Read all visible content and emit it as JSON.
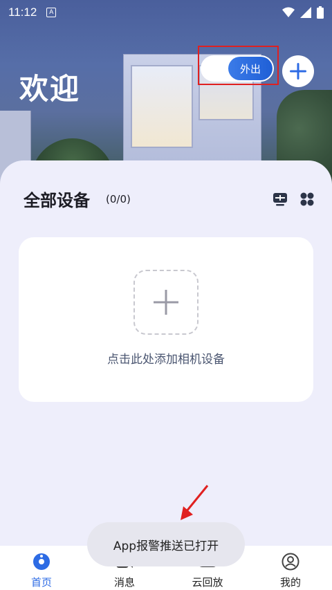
{
  "status_bar": {
    "time": "11:12",
    "notification_icon": "A"
  },
  "header": {
    "welcome": "欢迎",
    "mode_toggle_label": "外出"
  },
  "devices": {
    "title": "全部设备",
    "count": "(0/0)",
    "add_prompt": "点击此处添加相机设备"
  },
  "toast": {
    "text": "App报警推送已打开"
  },
  "bottom_nav": {
    "items": [
      {
        "label": "首页",
        "icon": "home-icon",
        "active": true
      },
      {
        "label": "消息",
        "icon": "message-icon",
        "active": false
      },
      {
        "label": "云回放",
        "icon": "cloud-playback-icon",
        "active": false
      },
      {
        "label": "我的",
        "icon": "profile-icon",
        "active": false
      }
    ]
  },
  "colors": {
    "accent": "#2d6be4",
    "highlight": "#e02020",
    "panel_bg": "#eeeefb"
  }
}
